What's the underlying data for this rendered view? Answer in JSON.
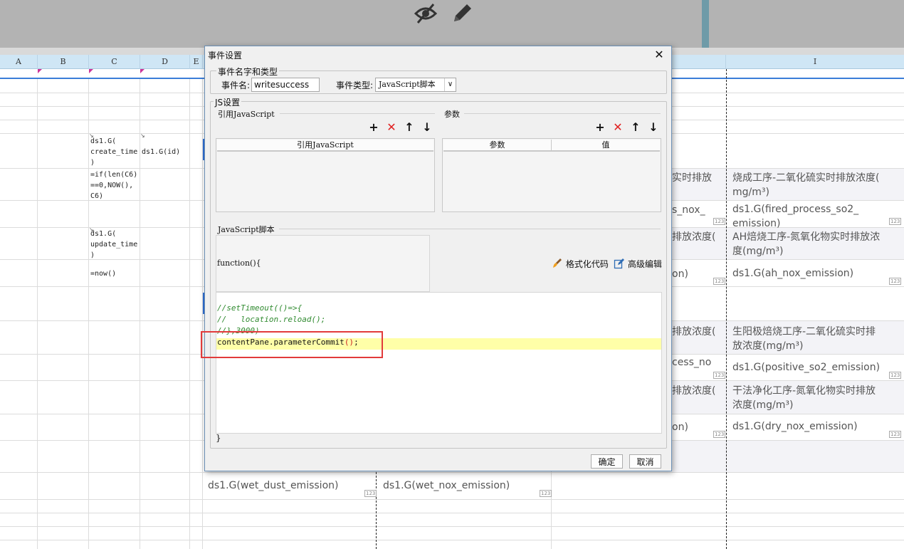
{
  "columns": [
    "A",
    "B",
    "C",
    "D",
    "E",
    "I"
  ],
  "cells": {
    "c_create_time": "ds1.G(\ncreate_time\n)",
    "d_id": "ds1.G(id)",
    "c_if_formula": "=if(len(C6)\n==0,NOW(),\nC6)",
    "c_update_time": "ds1.G(\nupdate_time\n)",
    "c_now": "=now()",
    "partial_1": "实时排放",
    "partial_2": "s_nox_",
    "partial_3": "排放浓度(",
    "partial_4": "on)",
    "partial_5": "排放浓度(",
    "partial_6": "cess_no",
    "partial_7": "排放浓度(",
    "partial_8": "on)",
    "i_so2_label": "烧成工序-二氧化硫实时排放浓度(\nmg/m³)",
    "i_fired_so2": "ds1.G(fired_process_so2_\nemission)",
    "i_ah_nox_label": "AH焙烧工序-氮氧化物实时排放浓\n度(mg/m³)",
    "i_ah_nox": "ds1.G(ah_nox_emission)",
    "i_positive_label": "生阳极焙烧工序-二氧化硫实时排\n放浓度(mg/m³)",
    "i_positive_so2": "ds1.G(positive_so2_emission)",
    "i_dry_label": "干法净化工序-氮氧化物实时排放\n浓度(mg/m³)",
    "i_dry_nox": "ds1.G(dry_nox_emission)",
    "wet_dust": "ds1.G(wet_dust_emission)",
    "wet_nox": "ds1.G(wet_nox_emission)",
    "badge": "123",
    "arrow": "↘"
  },
  "dialog": {
    "title": "事件设置",
    "close": "✕",
    "name_type_legend": "事件名字和类型",
    "event_name_label": "事件名:",
    "event_name_value": "writesuccess",
    "event_type_label": "事件类型:",
    "event_type_value": "JavaScript脚本",
    "event_type_chevron": "∨",
    "js_legend": "JS设置",
    "ref_js_title": "引用JavaScript",
    "params_title": "参数",
    "ref_js_column": "引用JavaScript",
    "param_column": "参数",
    "value_column": "值",
    "add": "+",
    "remove": "✕",
    "up": "↑",
    "down": "↓",
    "script_title": "JavaScript脚本",
    "function_header": "function(){",
    "format_code": "格式化代码",
    "advanced_edit": "高级编辑",
    "code": {
      "line1": "//setTimeout(()=>{",
      "line2": "//   location.reload();",
      "line3": "//},3000)",
      "line4_prefix": "contentPane.parameterCommit",
      "line4_parens": "()",
      "line4_suffix": ";"
    },
    "closing_brace": "}",
    "ok": "确定",
    "cancel": "取消"
  },
  "colors": {
    "accent_blue": "#2e6fd6",
    "highlight_red": "#e23b3b",
    "code_comment": "#2f8a2f",
    "current_line": "#ffffa8"
  }
}
